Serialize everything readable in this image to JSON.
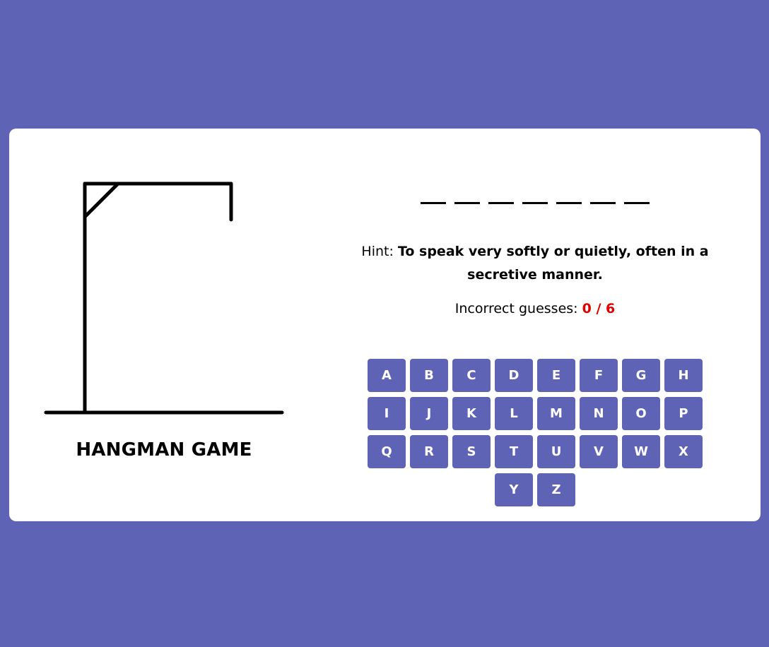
{
  "game": {
    "title": "HANGMAN GAME",
    "word_length": 7,
    "hint_label": "Hint:",
    "hint_text": "To speak very softly or quietly, often in a secretive manner.",
    "incorrect_label": "Incorrect guesses:",
    "incorrect_count": "0 / 6"
  },
  "keyboard": {
    "keys": [
      "A",
      "B",
      "C",
      "D",
      "E",
      "F",
      "G",
      "H",
      "I",
      "J",
      "K",
      "L",
      "M",
      "N",
      "O",
      "P",
      "Q",
      "R",
      "S",
      "T",
      "U",
      "V",
      "W",
      "X",
      "Y",
      "Z"
    ]
  },
  "colors": {
    "background": "#5E63B6",
    "key_background": "#5E63B6",
    "incorrect_count": "#E00000"
  }
}
